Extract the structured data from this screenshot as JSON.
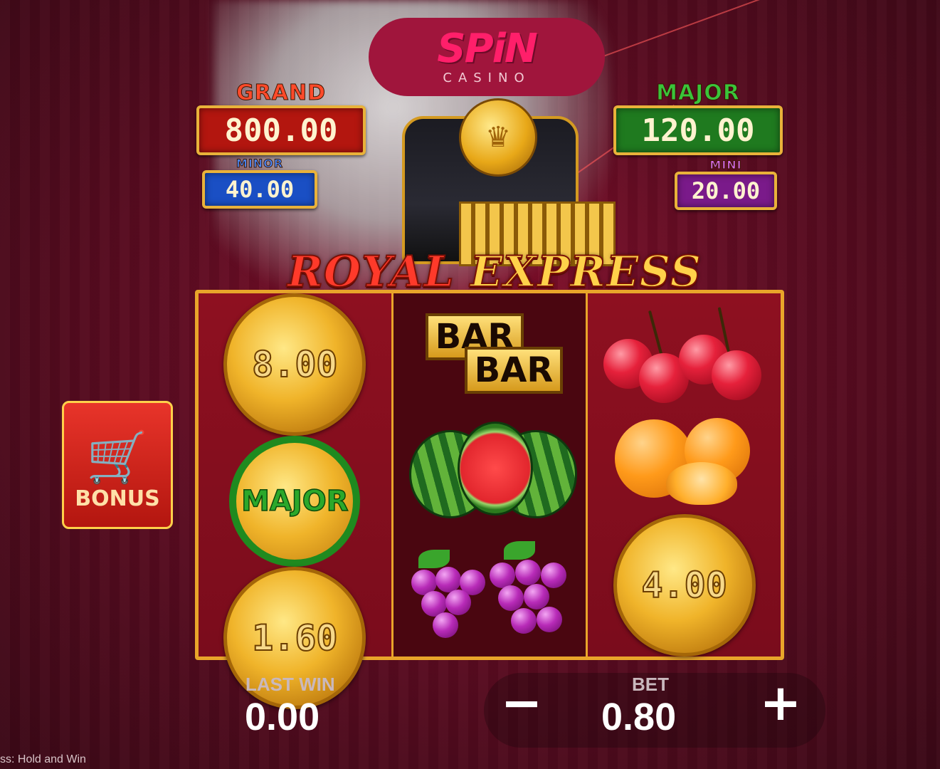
{
  "brand": {
    "name": "SPiN",
    "sub": "CASINO"
  },
  "jackpots": {
    "grand": {
      "label": "GRAND",
      "value": "800.00"
    },
    "minor": {
      "label": "MINOR",
      "value": "40.00"
    },
    "major": {
      "label": "MAJOR",
      "value": "120.00"
    },
    "mini": {
      "label": "MINI",
      "value": "20.00"
    }
  },
  "game": {
    "title_1": "ROYAL",
    "title_2": "EXPRESS"
  },
  "reels": {
    "reel1": {
      "top": "8.00",
      "middle": "MAJOR",
      "bottom": "1.60"
    },
    "reel2": {
      "bar_top": "BAR",
      "bar_bottom": "BAR"
    },
    "reel3": {
      "bottom": "4.00"
    }
  },
  "bonus": {
    "label": "BONUS",
    "icon": "shopping-cart-icon"
  },
  "controls": {
    "last_win_label": "LAST WIN",
    "last_win_value": "0.00",
    "bet_label": "BET",
    "bet_value": "0.80",
    "decrease": "−",
    "increase": "+"
  },
  "footer": {
    "text": "ss: Hold and Win"
  },
  "colors": {
    "grand": "#b3160f",
    "minor": "#1a4fc4",
    "major": "#1f7a1f",
    "mini": "#7a1a8a",
    "gold": "#e9a52a"
  }
}
